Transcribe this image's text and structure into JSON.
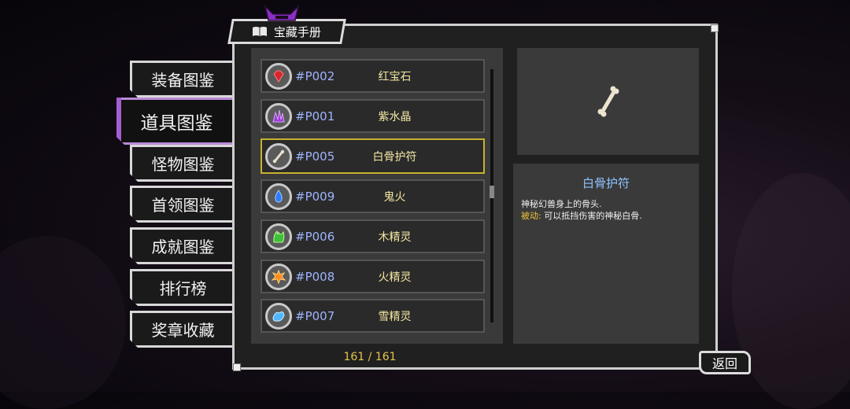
{
  "window": {
    "title": "宝藏手册",
    "book_icon": "book-icon",
    "emblem": "horned-emblem-icon"
  },
  "side_tabs": [
    {
      "label": "装备图鉴",
      "active": false
    },
    {
      "label": "道具图鉴",
      "active": true
    },
    {
      "label": "怪物图鉴",
      "active": false
    },
    {
      "label": "首领图鉴",
      "active": false
    },
    {
      "label": "成就图鉴",
      "active": false
    },
    {
      "label": "排行榜",
      "active": false
    },
    {
      "label": "奖章收藏",
      "active": false
    }
  ],
  "items": [
    {
      "id": "#P002",
      "name": "红宝石",
      "icon": "ruby-icon",
      "icon_color": "#d8262e"
    },
    {
      "id": "#P001",
      "name": "紫水晶",
      "icon": "amethyst-icon",
      "icon_color": "#9b3fd6"
    },
    {
      "id": "#P005",
      "name": "白骨护符",
      "icon": "bone-icon",
      "icon_color": "#e9e2cf",
      "selected": true
    },
    {
      "id": "#P009",
      "name": "鬼火",
      "icon": "will-o-wisp-icon",
      "icon_color": "#2f7dff"
    },
    {
      "id": "#P006",
      "name": "木精灵",
      "icon": "wood-spirit-icon",
      "icon_color": "#3fbf3a"
    },
    {
      "id": "#P008",
      "name": "火精灵",
      "icon": "fire-spirit-icon",
      "icon_color": "#ff8a1f"
    },
    {
      "id": "#P007",
      "name": "雪精灵",
      "icon": "snow-spirit-icon",
      "icon_color": "#4fb6ff"
    }
  ],
  "count": "161 / 161",
  "detail": {
    "title": "白骨护符",
    "preview_icon": "bone-icon",
    "line1": "神秘幻兽身上的骨头.",
    "passive_label": "被动:",
    "passive_text": " 可以抵挡伤害的神秘白骨."
  },
  "back_label": "返回"
}
